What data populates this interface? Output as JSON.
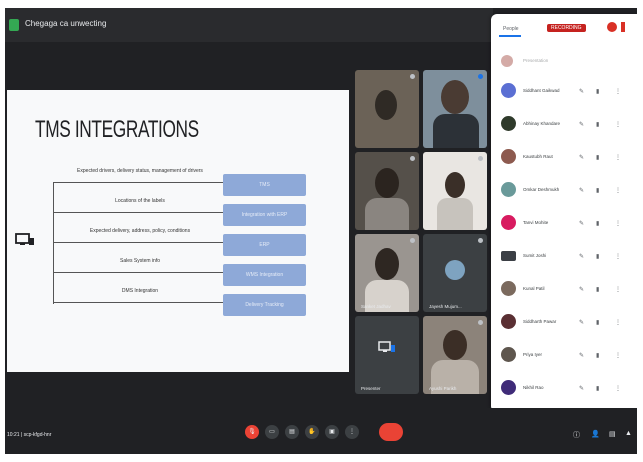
{
  "meeting": {
    "title": "Chegaga ca unwecting"
  },
  "slide": {
    "title": "TMS INTEGRATIONS",
    "rows": [
      {
        "label": "Expected drivers, delivery status, management of drivers"
      },
      {
        "label": "Locations of the labels"
      },
      {
        "label": "Expected delivery, address, policy, conditions"
      },
      {
        "label": "Sales System info"
      },
      {
        "label": "DMS Integration"
      }
    ],
    "pills": [
      "TMS",
      "Integration with ERP",
      "ERP",
      "WMS Integration",
      "Delivery Tracking"
    ]
  },
  "tiles": [
    {
      "name": ""
    },
    {
      "name": ""
    },
    {
      "name": ""
    },
    {
      "name": ""
    },
    {
      "name": "Sanket Jadhav"
    },
    {
      "name": "Jayesh Mujum..."
    },
    {
      "name": "Presenter"
    },
    {
      "name": "Ayushi Parikh"
    }
  ],
  "people": {
    "tab_label": "People",
    "record_label": "RECORDING",
    "list": [
      {
        "name": "Presentation"
      },
      {
        "name": "Siddhant Gaikwad"
      },
      {
        "name": "Abhinay Khandare"
      },
      {
        "name": "Kaustubh Raut"
      },
      {
        "name": "Omkar Deshmukh"
      },
      {
        "name": "Tanvi Mohite"
      },
      {
        "name": "Sumit Joshi"
      },
      {
        "name": "Kunal Patil"
      },
      {
        "name": "Siddharth Pawar"
      },
      {
        "name": "Priya Iyer"
      },
      {
        "name": "Nikhil Rao"
      }
    ]
  },
  "bottombar": {
    "time_label": "10:21 | scp-kfgd-hnr"
  },
  "colors": {
    "pill": "#8ea9d8",
    "end_call": "#ea4335",
    "panel_bg": "#ffffff",
    "app_bg": "#202124"
  }
}
